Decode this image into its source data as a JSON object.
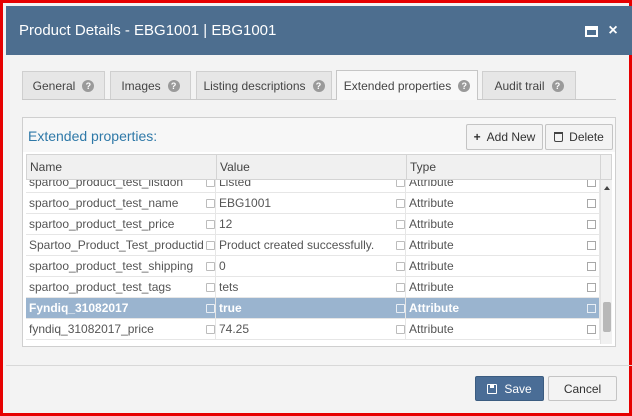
{
  "window": {
    "title": "Product Details - EBG1001 | EBG1001",
    "close_glyph": "×"
  },
  "tabs": [
    {
      "label": "General"
    },
    {
      "label": "Images"
    },
    {
      "label": "Listing descriptions"
    },
    {
      "label": "Extended properties",
      "active": true
    },
    {
      "label": "Audit trail"
    }
  ],
  "panel": {
    "title": "Extended properties:",
    "add_label": "Add New",
    "add_glyph": "+",
    "delete_label": "Delete"
  },
  "grid": {
    "columns": [
      "Name",
      "Value",
      "Type"
    ],
    "rows": [
      {
        "name": "spartoo_product_test_listdon",
        "value": "Listed",
        "type": "Attribute"
      },
      {
        "name": "spartoo_product_test_name",
        "value": "EBG1001",
        "type": "Attribute"
      },
      {
        "name": "spartoo_product_test_price",
        "value": "12",
        "type": "Attribute"
      },
      {
        "name": "Spartoo_Product_Test_productid",
        "value": "Product created successfully.",
        "type": "Attribute"
      },
      {
        "name": "spartoo_product_test_shipping",
        "value": "0",
        "type": "Attribute"
      },
      {
        "name": "spartoo_product_test_tags",
        "value": "tets",
        "type": "Attribute"
      },
      {
        "name": "Fyndiq_31082017",
        "value": "true",
        "type": "Attribute",
        "selected": true
      },
      {
        "name": "fyndiq_31082017_price",
        "value": "74.25",
        "type": "Attribute"
      }
    ]
  },
  "footer": {
    "save_label": "Save",
    "cancel_label": "Cancel"
  },
  "icons": {
    "help": "question-circle-icon",
    "add": "plus-icon",
    "delete": "trash-icon",
    "edit": "pencil-icon",
    "dropdown": "dropdown-icon",
    "save": "floppy-disk-icon",
    "maximize": "maximize-icon",
    "close": "close-icon"
  },
  "colors": {
    "titlebar": "#4d6e8f",
    "accent_text": "#2f79a8",
    "selected_row": "#9ab4cf",
    "save_button": "#4a6d96",
    "frame_border": "#e60000"
  }
}
